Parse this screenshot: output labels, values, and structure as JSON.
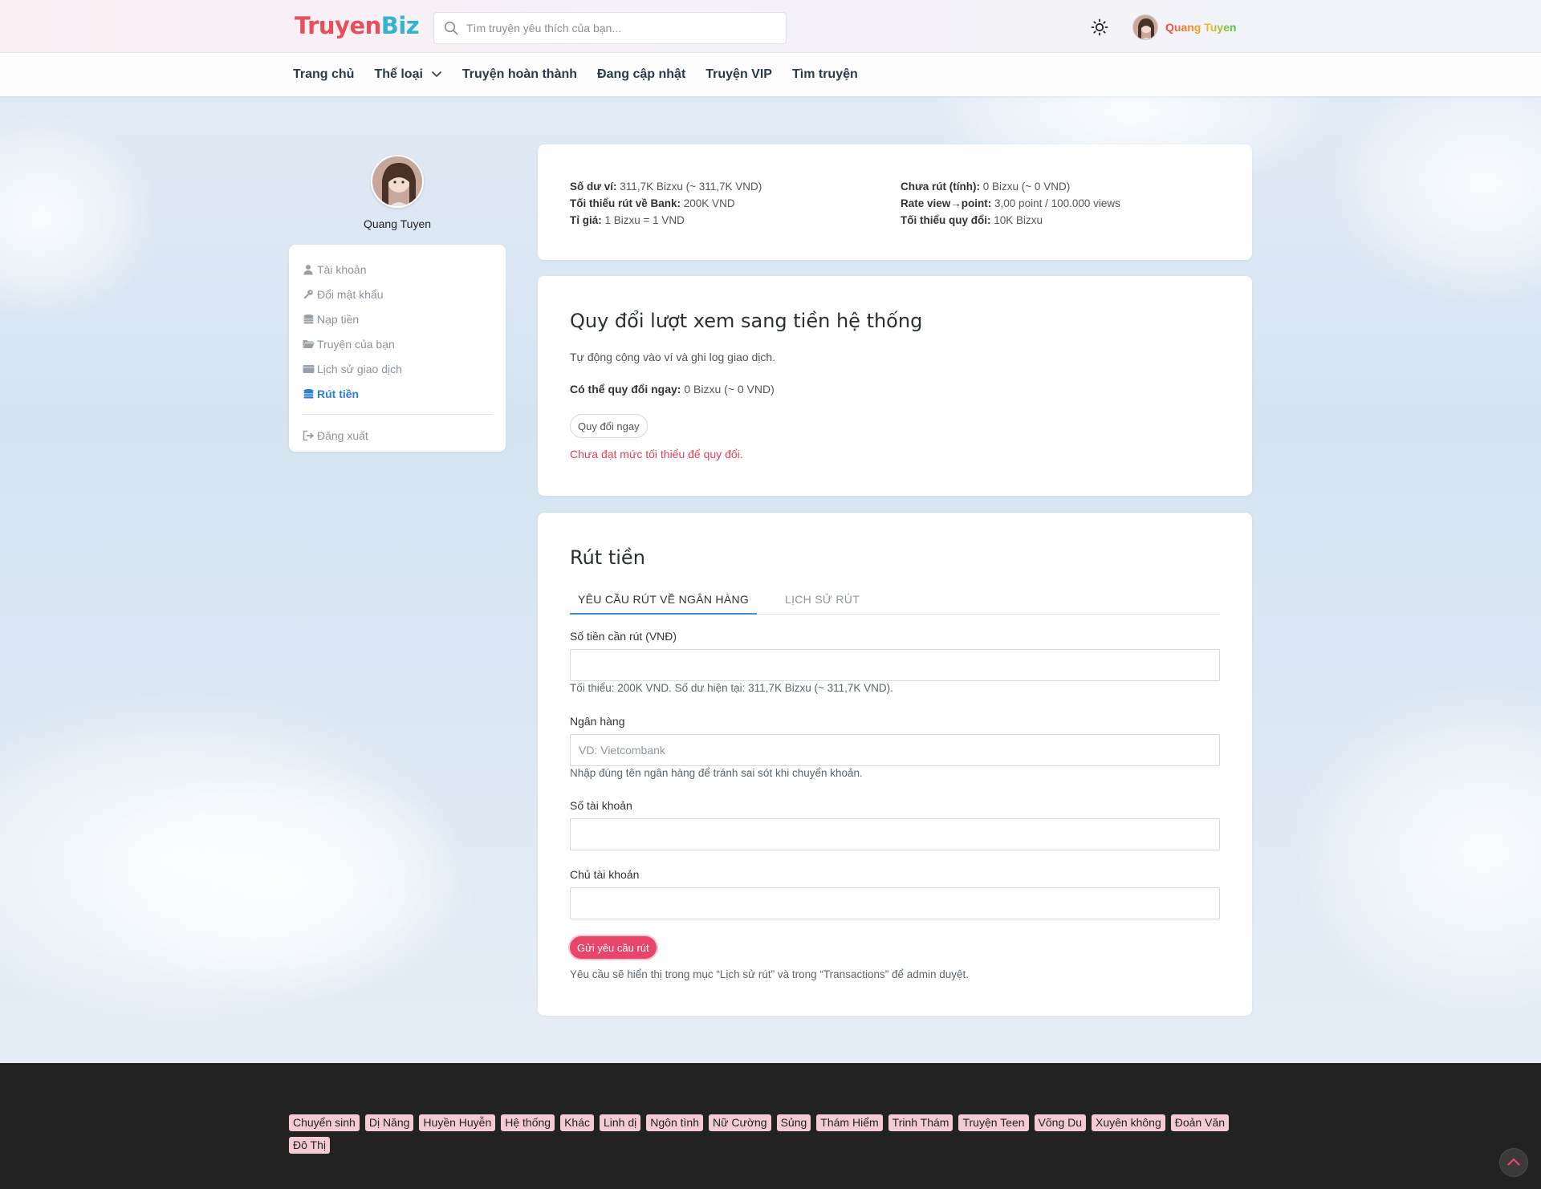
{
  "header": {
    "logo_part1": "Truyen",
    "logo_part2": "Biz",
    "search_placeholder": "Tìm truyện yêu thích của bạn...",
    "user_name": "Quang Tuyen"
  },
  "nav": {
    "items": [
      "Trang chủ",
      "Thể loại",
      "Truyện hoàn thành",
      "Đang cập nhật",
      "Truyện VIP",
      "Tìm truyện"
    ]
  },
  "sidebar": {
    "profile_name": "Quang Tuyen",
    "items": [
      {
        "label": "Tài khoản",
        "icon": "user-icon"
      },
      {
        "label": "Đổi mật khẩu",
        "icon": "key-icon"
      },
      {
        "label": "Nạp tiền",
        "icon": "coins-icon"
      },
      {
        "label": "Truyện của bạn",
        "icon": "folder-icon"
      },
      {
        "label": "Lịch sử giao dịch",
        "icon": "wallet-icon"
      },
      {
        "label": "Rút tiền",
        "icon": "coins-icon"
      },
      {
        "label": "Đăng xuất",
        "icon": "logout-icon"
      }
    ],
    "active_index": 5
  },
  "balance_card": {
    "col1": [
      {
        "label": "Số dư ví:",
        "value": "311,7K Bizxu (~ 311,7K VND)"
      },
      {
        "label": "Tối thiểu rút về Bank:",
        "value": "200K VND"
      },
      {
        "label": "Tỉ giá:",
        "value": "1 Bizxu = 1 VND"
      }
    ],
    "col2": [
      {
        "label": "Chưa rút (tính):",
        "value": "0 Bizxu (~ 0 VND)"
      },
      {
        "label": "Rate view→point:",
        "value": "3,00 point / 100.000 views"
      },
      {
        "label": "Tối thiểu quy đổi:",
        "value": "10K Bizxu"
      }
    ]
  },
  "convert_card": {
    "title": "Quy đổi lượt xem sang tiền hệ thống",
    "description": "Tự động cộng vào ví và ghi log giao dịch.",
    "available_label": "Có thể quy đổi ngay:",
    "available_value": "0 Bizxu (~ 0 VND)",
    "button_label": "Quy đổi ngay",
    "error_text": "Chưa đạt mức tối thiểu để quy đổi."
  },
  "withdraw_card": {
    "title": "Rút tiền",
    "tabs": [
      "YÊU CẦU RÚT VỀ NGÂN HÀNG",
      "LỊCH SỬ RÚT"
    ],
    "amount_label": "Số tiền cần rút (VNĐ)",
    "amount_value": "",
    "amount_help": "Tối thiểu: 200K VND. Số dư hiện tại: 311,7K Bizxu (~ 311,7K VND).",
    "bank_label": "Ngân hàng",
    "bank_placeholder": "VD: Vietcombank",
    "bank_help": "Nhập đúng tên ngân hàng để tránh sai sót khi chuyển khoản.",
    "account_number_label": "Số tài khoản",
    "account_number_value": "",
    "account_holder_label": "Chủ tài khoản",
    "account_holder_value": "",
    "submit_label": "Gửi yêu cầu rút",
    "note": "Yêu cầu sẽ hiển thị trong mục “Lịch sử rút” và trong “Transactions” để admin duyệt."
  },
  "footer": {
    "tags": [
      "Chuyển sinh",
      "Dị Năng",
      "Huyền Huyễn",
      "Hệ thống",
      "Khác",
      "Linh dị",
      "Ngôn tình",
      "Nữ Cường",
      "Sủng",
      "Thám Hiểm",
      "Trinh Thám",
      "Truyện Teen",
      "Võng Du",
      "Xuyên không",
      "Đoản Văn",
      "Đô Thị"
    ]
  },
  "colors": {
    "accent": "#2d7fd6",
    "primary_button": "#e9456a",
    "error": "#e0435a",
    "tag_bg": "#f4cad5",
    "footer_bg": "#222222"
  }
}
